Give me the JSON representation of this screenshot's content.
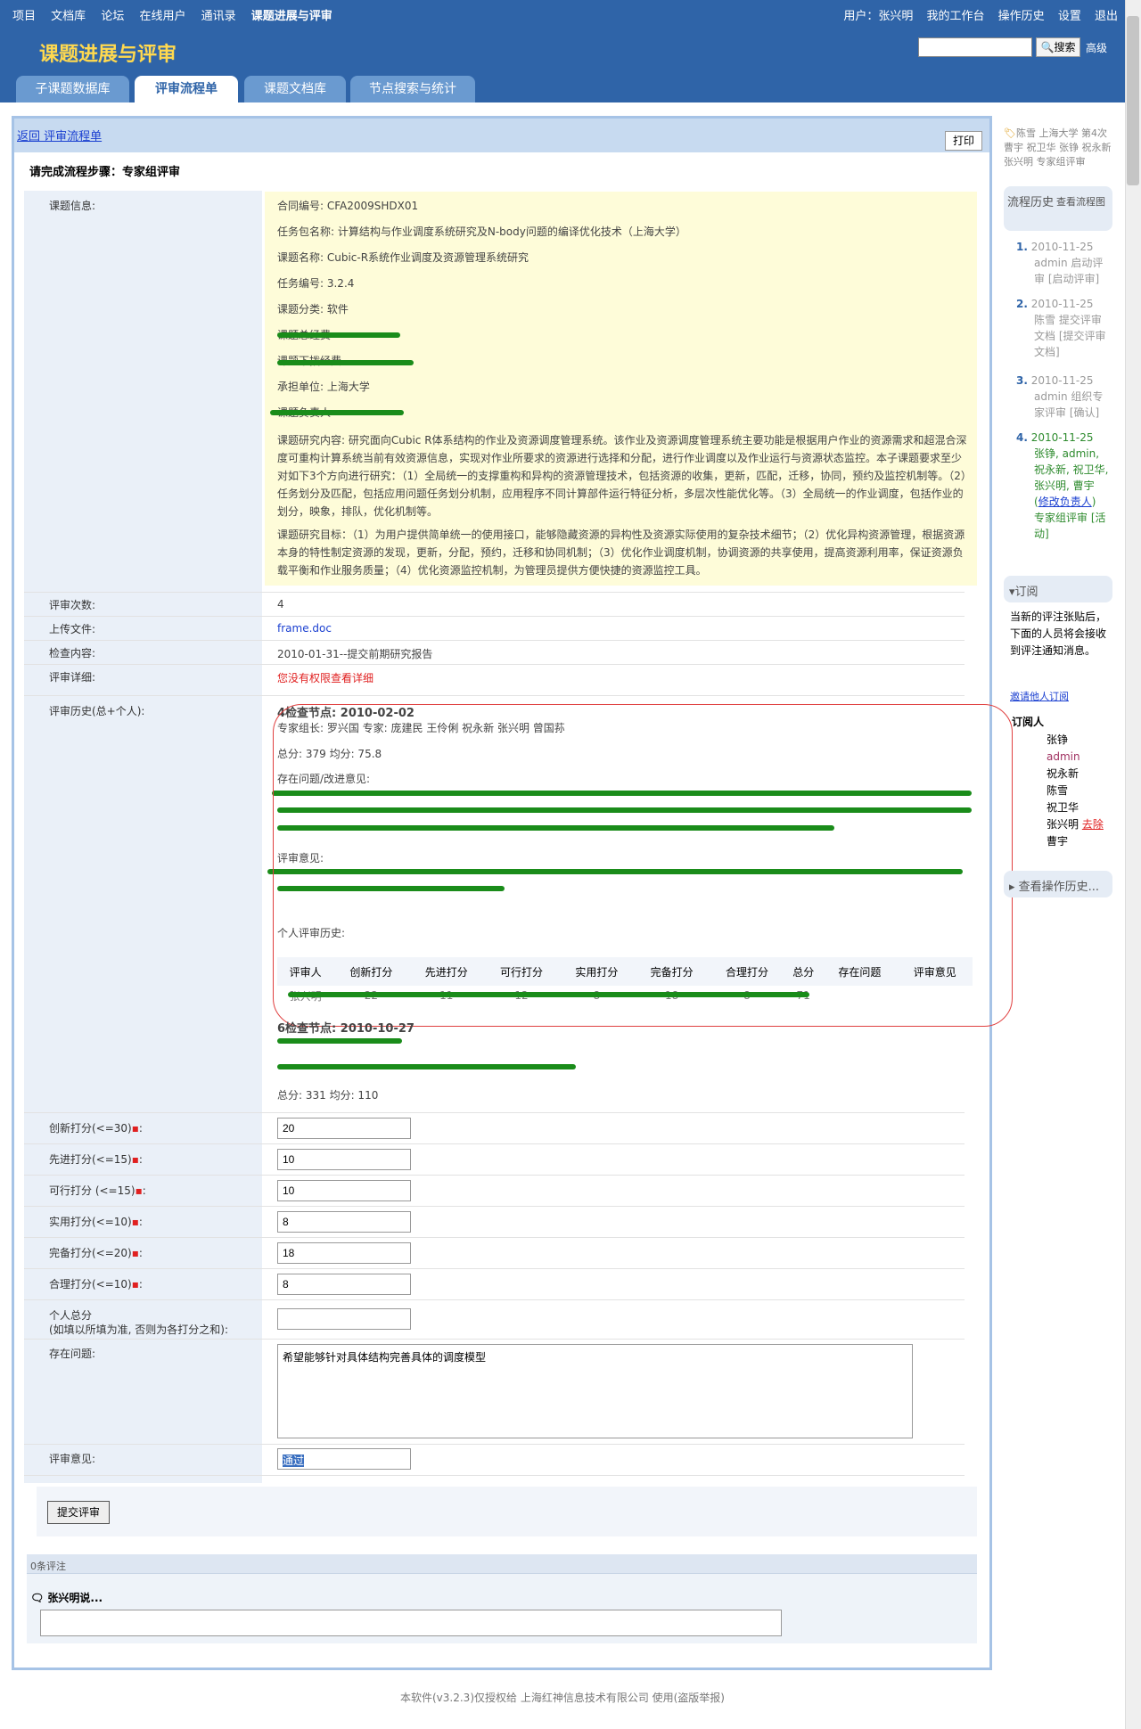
{
  "topnav": {
    "items": [
      "项目",
      "文档库",
      "论坛",
      "在线用户",
      "通讯录",
      "课题进展与评审"
    ],
    "user_label": "用户：",
    "user_name": "张兴明",
    "right_items": [
      "我的工作台",
      "操作历史",
      "设置",
      "退出"
    ]
  },
  "header": {
    "title": "课题进展与评审",
    "search_placeholder": "",
    "search_button": "搜索",
    "advanced": "高级"
  },
  "tabs": [
    "子课题数据库",
    "评审流程单",
    "课题文档库",
    "节点搜索与统计"
  ],
  "panel": {
    "back_link": "返回 评审流程单",
    "print": "打印",
    "step_title": "请完成流程步骤：专家组评审"
  },
  "labels": {
    "topic_info": "课题信息:",
    "review_count": "评审次数:",
    "upload_file": "上传文件:",
    "check_content": "检查内容:",
    "review_detail": "评审详细:",
    "review_history": "评审历史(总+个人):",
    "innovation": "创新打分(<=30)",
    "advanced": "先进打分(<=15)",
    "feasible": "可行打分 (<=15)",
    "practical": "实用打分(<=10)",
    "complete": "完备打分(<=20)",
    "reasonable": "合理打分(<=10)",
    "personal_total": "个人总分",
    "personal_total_note": "(如填以所填为准, 否则为各打分之和):",
    "problems": "存在问题:",
    "opinion": "评审意见:"
  },
  "topic": {
    "contract": "合同编号: CFA2009SHDX01",
    "package": "任务包名称: 计算结构与作业调度系统研究及N-body问题的编译优化技术（上海大学）",
    "name": "课题名称: Cubic-R系统作业调度及资源管理系统研究",
    "task_no": "任务编号: 3.2.4",
    "category": "课题分类: 软件",
    "budget": "课题总经费",
    "fund": "课题下拨经费",
    "unit": "承担单位: 上海大学",
    "leader": "课题负责人",
    "content": "课题研究内容: 研究面向Cubic R体系结构的作业及资源调度管理系统。该作业及资源调度管理系统主要功能是根据用户作业的资源需求和超混合深度可重构计算系统当前有效资源信息，实现对作业所要求的资源进行选择和分配，进行作业调度以及作业运行与资源状态监控。本子课题要求至少对如下3个方向进行研究：（1）全局统一的支撑重构和异构的资源管理技术，包括资源的收集，更新，匹配，迁移，协同，预约及监控机制等。（2）任务划分及匹配，包括应用问题任务划分机制，应用程序不同计算部件运行特征分析，多层次性能优化等。（3）全局统一的作业调度，包括作业的划分，映象，排队，优化机制等。",
    "goal": "课题研究目标：（1）为用户提供简单统一的使用接口，能够隐藏资源的异构性及资源实际使用的复杂技术细节；（2）优化异构资源管理，根据资源本身的特性制定资源的发现，更新，分配，预约，迁移和协同机制；（3）优化作业调度机制，协调资源的共享使用，提高资源利用率，保证资源负载平衡和作业服务质量；（4）优化资源监控机制，为管理员提供方便快捷的资源监控工具。"
  },
  "review_count": "4",
  "upload_file": "frame.doc",
  "check_content": "2010-01-31--提交前期研究报告",
  "review_detail": "您没有权限查看详细",
  "history": {
    "node1_title": "4检查节点: 2010-02-02",
    "node1_members": "专家组长: 罗兴国 专家: 庞建民 王伶俐 祝永新 张兴明 曾国荪",
    "node1_score": "总分: 379 均分: 75.8",
    "problems_label": "存在问题/改进意见:",
    "opinion_label": "评审意见:",
    "personal_history_label": "个人评审历史:",
    "table_headers": [
      "评审人",
      "创新打分",
      "先进打分",
      "可行打分",
      "实用打分",
      "完备打分",
      "合理打分",
      "总分",
      "存在问题",
      "评审意见"
    ],
    "table_row": [
      "张兴明",
      "22",
      "11",
      "12",
      "8",
      "18",
      "8",
      "71",
      "",
      ""
    ],
    "node2_title": "6检查节点: 2010-10-27",
    "node2_line1": "",
    "node2_line2": "",
    "node2_score": "总分: 331 均分: 110"
  },
  "form": {
    "innovation": "20",
    "advanced": "10",
    "feasible": "10",
    "practical": "8",
    "complete": "18",
    "reasonable": "8",
    "personal_total": "",
    "problems": "希望能够针对具体结构完善具体的调度模型",
    "opinion": "通过",
    "submit": "提交评审"
  },
  "comments": {
    "count": "0条评注",
    "author": "张兴明说..."
  },
  "sidebar": {
    "tags": "陈雪 上海大学 第4次 曹宇 祝卫华 张铮 祝永新 张兴明 专家组评审",
    "flow_title": "流程历史",
    "view_chart": "查看流程图",
    "history": [
      {
        "num": "1.",
        "date": "2010-11-25",
        "text": "admin 启动评审 [启动评审]"
      },
      {
        "num": "2.",
        "date": "2010-11-25",
        "text": "陈雪 提交评审文档 [提交评审文档]"
      },
      {
        "num": "3.",
        "date": "2010-11-25",
        "text": "admin 组织专家评审 [确认]"
      },
      {
        "num": "4.",
        "date": "2010-11-25",
        "text": "张铮, admin, 祝永新, 祝卫华, 张兴明, 曹宇",
        "link": "修改负责人",
        "tail": "专家组评审 [活动]"
      }
    ],
    "subscribe_title": "订阅",
    "subscribe_text": "当新的评注张贴后，下面的人员将会接收到评注通知消息。",
    "invite": "邀请他人订阅",
    "subscribers_title": "订阅人",
    "subscribers": [
      "张铮",
      "admin",
      "祝永新",
      "陈雪",
      "祝卫华",
      "张兴明",
      "曹宇"
    ],
    "remove": "去除",
    "view_ops": "查看操作历史..."
  },
  "footer": "本软件(v3.2.3)仅授权给 上海红神信息技术有限公司 使用(盗版举报)",
  "colors": {
    "nav_bg": "#2f64a8",
    "title_yellow": "#ffd94f",
    "panel_border": "#a6c3e6",
    "info_bg": "#fefcd9",
    "strike_green": "#1a8c1a",
    "highlight_red": "#e02020"
  }
}
